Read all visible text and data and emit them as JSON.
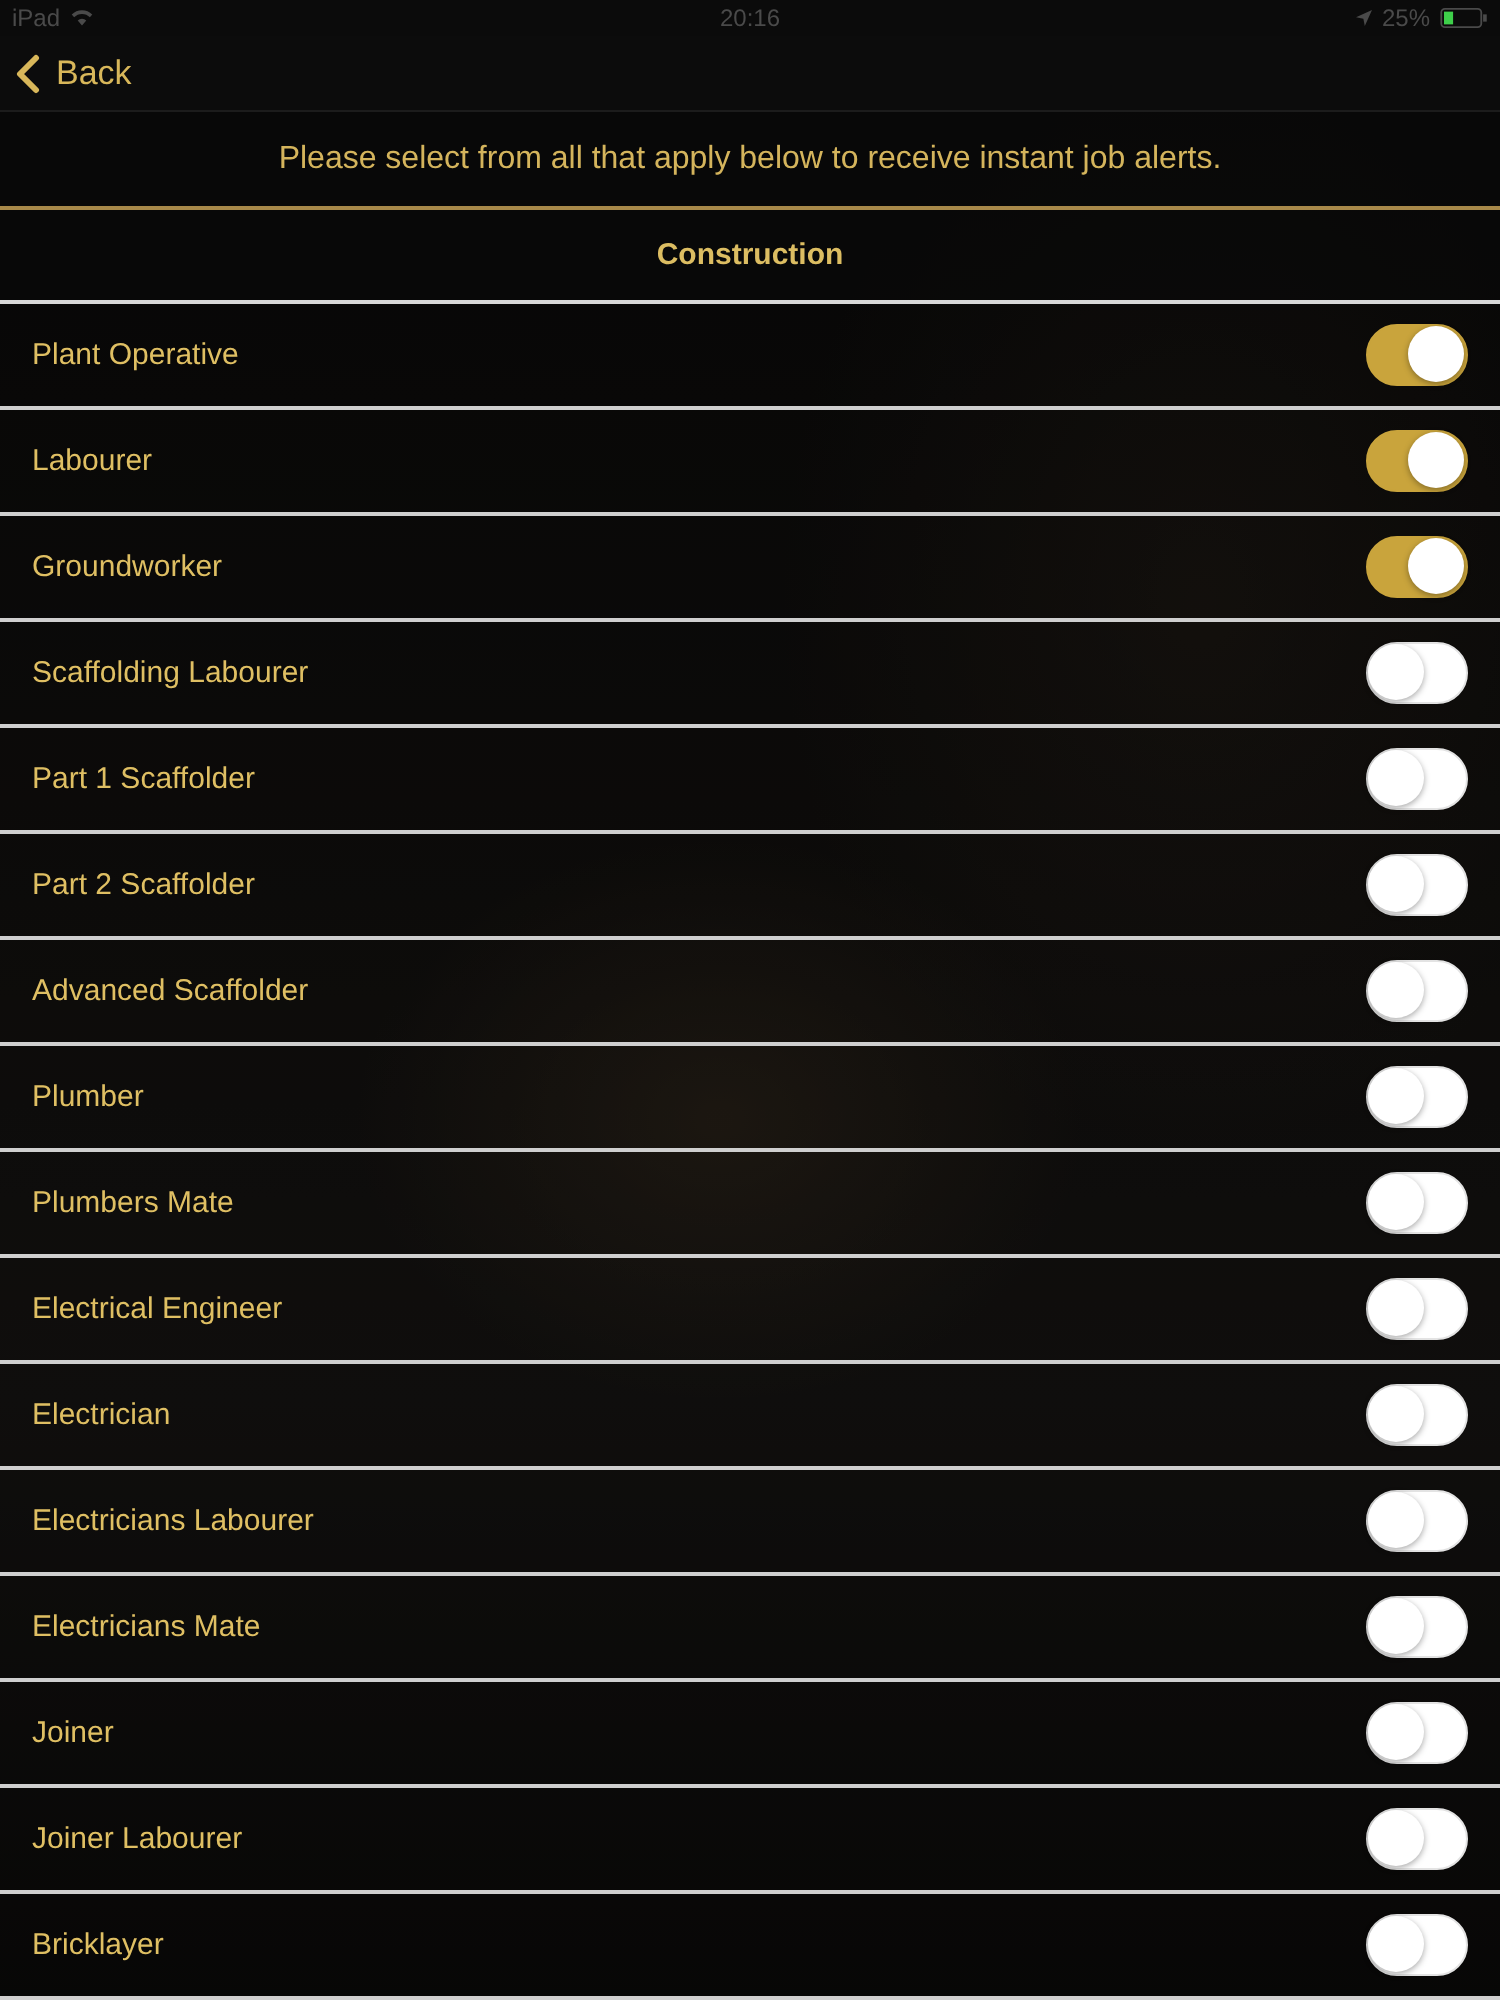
{
  "status_bar": {
    "carrier": "iPad",
    "time": "20:16",
    "battery": "25%"
  },
  "nav": {
    "back_label": "Back"
  },
  "intro": "Please select from all that apply below to receive instant job alerts.",
  "sections": [
    {
      "title": "Construction",
      "items": [
        {
          "label": "Plant Operative",
          "on": true
        },
        {
          "label": "Labourer",
          "on": true
        },
        {
          "label": "Groundworker",
          "on": true
        },
        {
          "label": "Scaffolding Labourer",
          "on": false
        },
        {
          "label": "Part 1 Scaffolder",
          "on": false
        },
        {
          "label": "Part 2 Scaffolder",
          "on": false
        },
        {
          "label": "Advanced Scaffolder",
          "on": false
        },
        {
          "label": "Plumber",
          "on": false
        },
        {
          "label": "Plumbers Mate",
          "on": false
        },
        {
          "label": "Electrical Engineer",
          "on": false
        },
        {
          "label": "Electrician",
          "on": false
        },
        {
          "label": "Electricians Labourer",
          "on": false
        },
        {
          "label": "Electricians Mate",
          "on": false
        },
        {
          "label": "Joiner",
          "on": false
        },
        {
          "label": "Joiner Labourer",
          "on": false
        },
        {
          "label": "Bricklayer",
          "on": false
        }
      ]
    }
  ]
}
